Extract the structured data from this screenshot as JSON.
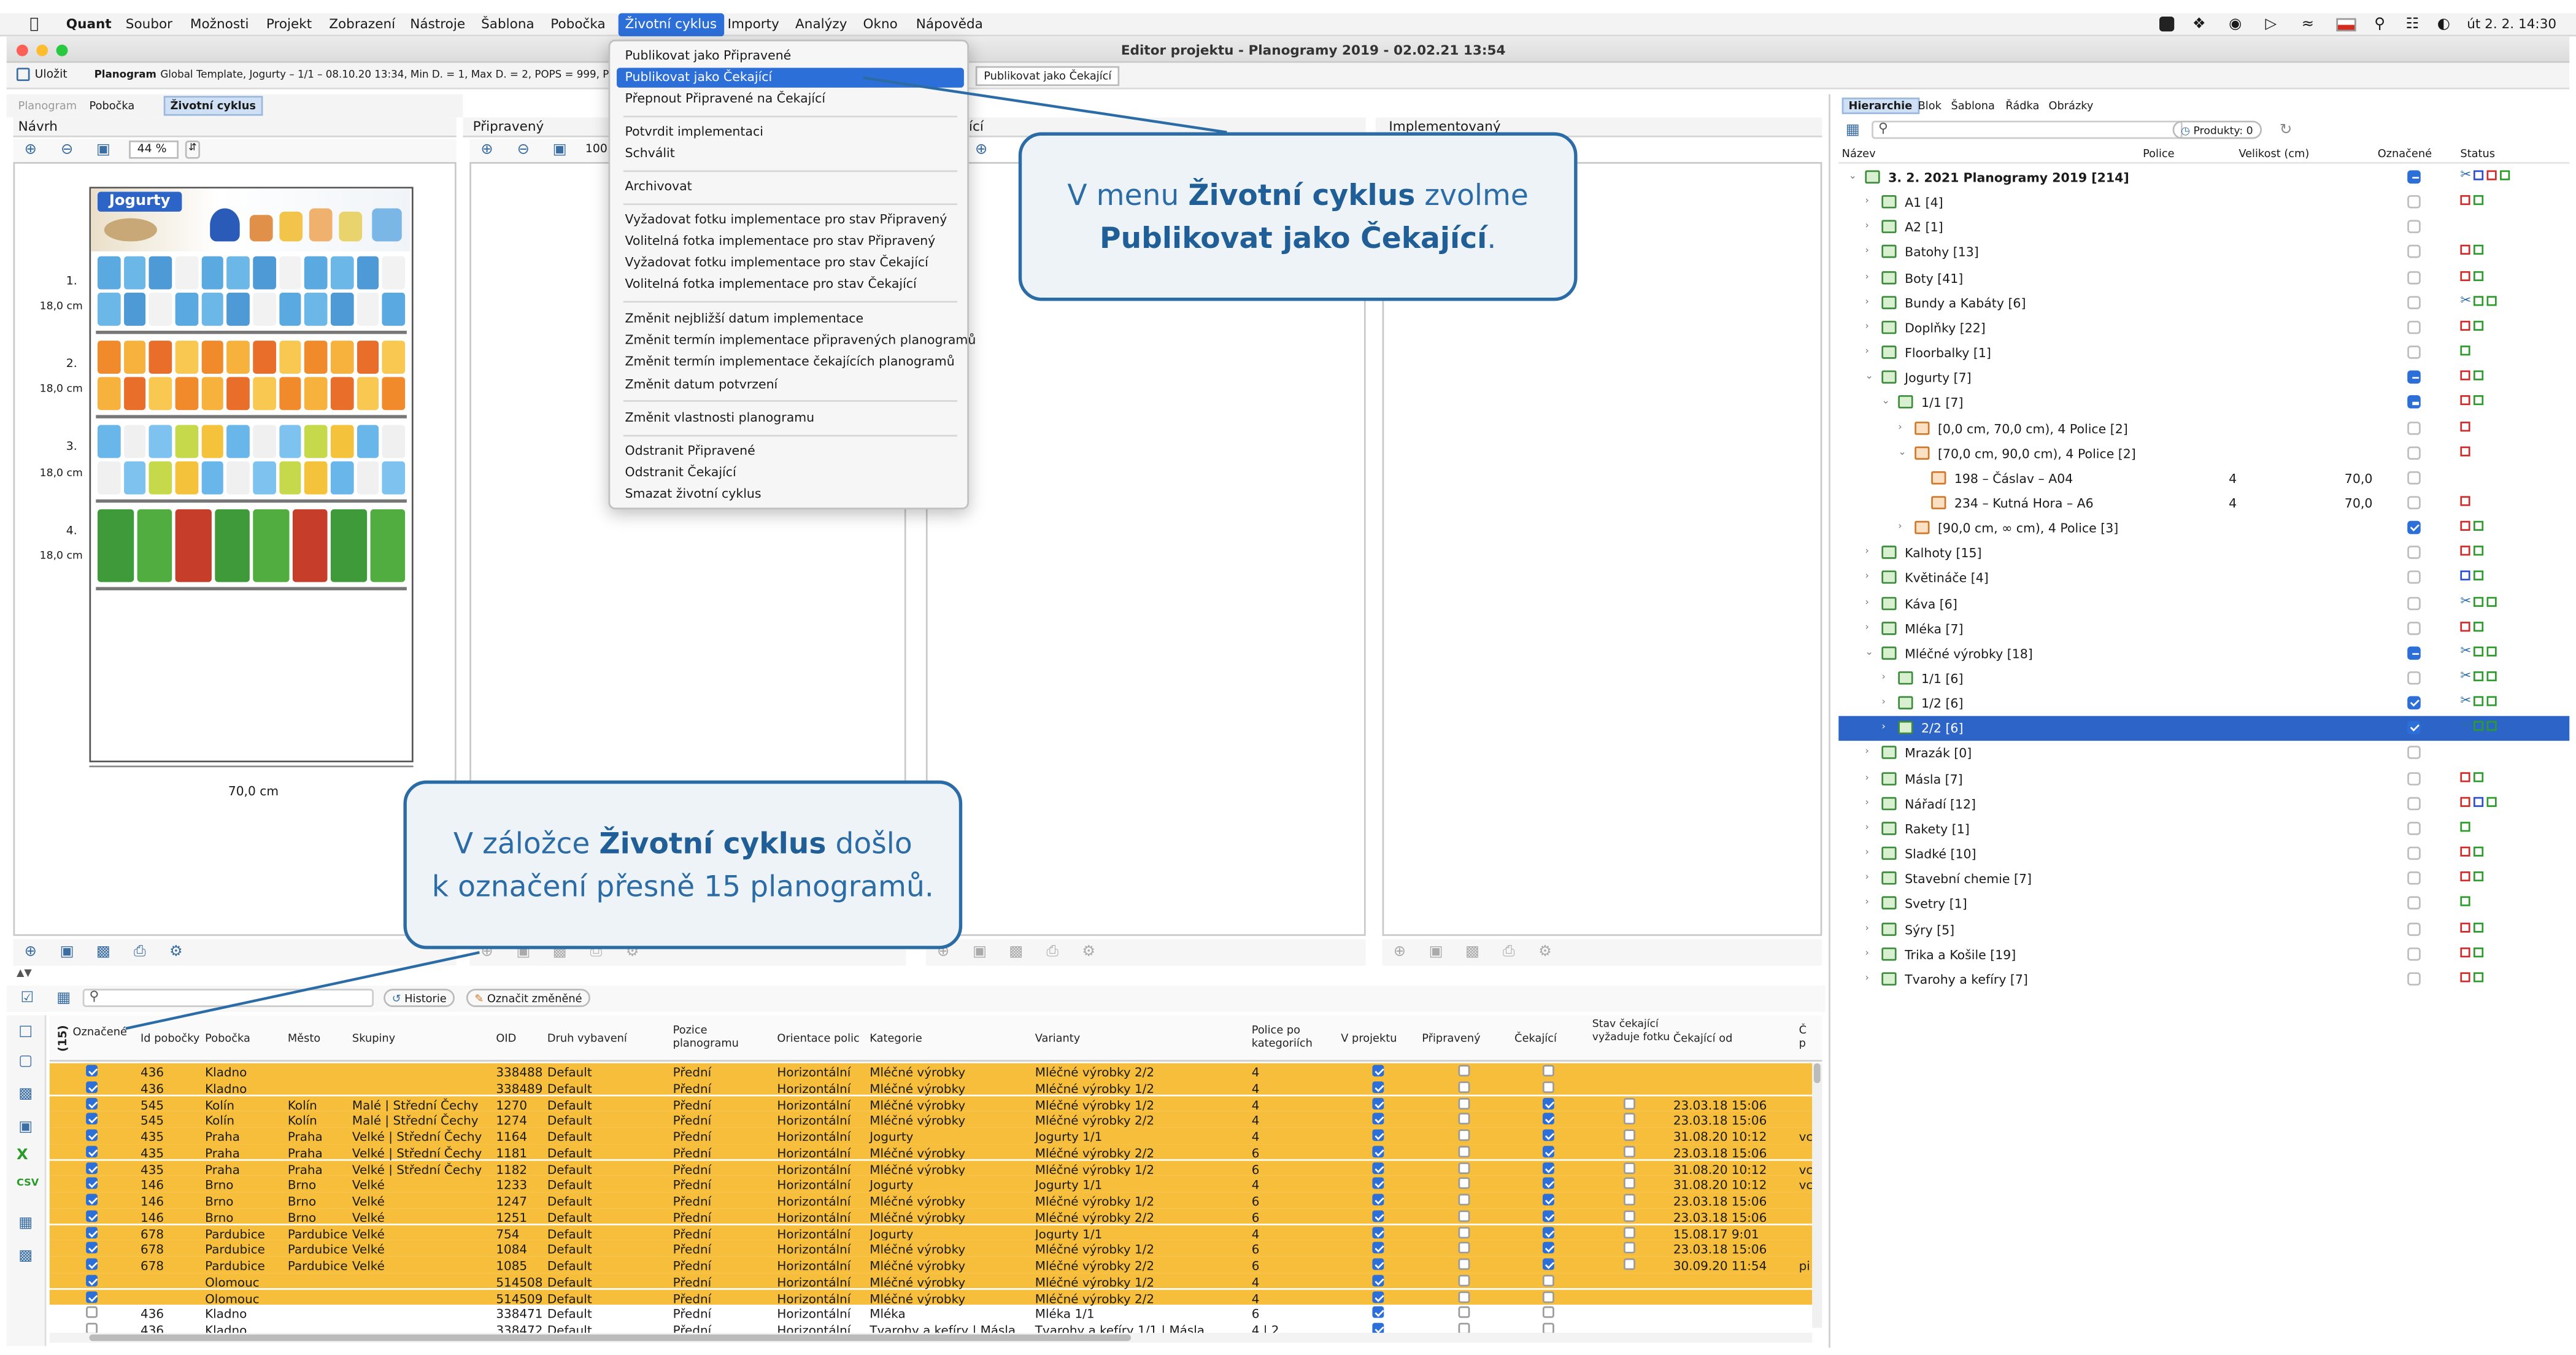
{
  "menubar": {
    "apple": "",
    "app": "Quant",
    "items": [
      "Soubor",
      "Možnosti",
      "Projekt",
      "Zobrazení",
      "Nástroje",
      "Šablona",
      "Pobočka",
      "Životní cyklus",
      "Importy",
      "Analýzy",
      "Okno",
      "Nápověda"
    ],
    "clock": "út 2. 2.  14:30"
  },
  "window": {
    "title": "Editor projektu - Planogramy 2019 - 02.02.21 13:54",
    "save_label": "Uložit",
    "planogram_label": "Planogram",
    "planogram_info": "Global Template, Jogurty – 1/1 – 08.10.20 13:34, Min D. = 1, Max D. = 2, POPS = 999, Prodan",
    "tooltip": "Publikovat jako Čekající"
  },
  "left_tabs": [
    "Planogram",
    "Pobočka",
    "Životní cyklus"
  ],
  "panes": {
    "navrh": "Návrh",
    "pripraveny": "Připravený",
    "cekajici": "ící",
    "implementovany": "Implementovaný",
    "zoom": "44 %",
    "zoom2": "100",
    "width_label": "70,0 cm",
    "shelf_no": [
      "1.",
      "2.",
      "3.",
      "4."
    ],
    "shelf_h": [
      "18,0 cm",
      "18,0 cm",
      "18,0 cm",
      "18,0 cm"
    ],
    "header_label": "Jogurty"
  },
  "menu": {
    "items": [
      "Publikovat jako Připravené",
      "Publikovat jako Čekající",
      "Přepnout Připravené na Čekající",
      "Potvrdit implementaci",
      "Schválit",
      "Archivovat",
      "Vyžadovat fotku implementace pro stav Připravený",
      "Volitelná fotka implementace pro stav Připravený",
      "Vyžadovat fotku implementace pro stav Čekající",
      "Volitelná fotka implementace pro stav Čekající",
      "Změnit nejbližší datum implementace",
      "Změnit termín implementace připravených planogramů",
      "Změnit termín implementace čekajících planogramů",
      "Změnit datum potvrzení",
      "Změnit vlastnosti planogramu",
      "Odstranit Připravené",
      "Odstranit Čekající",
      "Smazat životní cyklus"
    ]
  },
  "callouts": {
    "top_pre": "V menu ",
    "top_b1": "Životní cyklus",
    "top_mid": " zvolme",
    "top_b2": "Publikovat jako Čekající",
    "top_end": ".",
    "bottom_pre": "V záložce ",
    "bottom_b": "Životní cyklus",
    "bottom_mid": " došlo",
    "bottom_line2": "k označení přesně 15 planogramů."
  },
  "right": {
    "tabs": [
      "Hierarchie",
      "Blok",
      "Šablona",
      "Řádka",
      "Obrázky"
    ],
    "products": "Produkty: 0",
    "cols": [
      "Název",
      "Police",
      "Velikost (cm)",
      "Označené",
      "Status"
    ],
    "rows": [
      {
        "l": "3. 2. 2021 Planogramy 2019 [214]",
        "bold": true
      },
      {
        "l": "A1 [4]"
      },
      {
        "l": "A2 [1]"
      },
      {
        "l": "Batohy [13]"
      },
      {
        "l": "Boty [41]"
      },
      {
        "l": "Bundy a Kabáty [6]"
      },
      {
        "l": "Doplňky [22]"
      },
      {
        "l": "Floorbalky [1]"
      },
      {
        "l": "Jogurty [7]"
      },
      {
        "l": "1/1 [7]"
      },
      {
        "l": "[0,0 cm, 70,0 cm), 4 Police [2]"
      },
      {
        "l": "[70,0 cm, 90,0 cm), 4 Police [2]"
      },
      {
        "l": "198 – Čáslav – A04",
        "p": "4",
        "v": "70,0"
      },
      {
        "l": "234 – Kutná Hora – A6",
        "p": "4",
        "v": "70,0"
      },
      {
        "l": "[90,0 cm, ∞ cm), 4 Police [3]"
      },
      {
        "l": "Kalhoty [15]"
      },
      {
        "l": "Květináče [4]"
      },
      {
        "l": "Káva [6]"
      },
      {
        "l": "Mléka [7]"
      },
      {
        "l": "Mléčné výrobky [18]"
      },
      {
        "l": "1/1 [6]"
      },
      {
        "l": "1/2 [6]"
      },
      {
        "l": "2/2 [6]"
      },
      {
        "l": "Mrazák [0]"
      },
      {
        "l": "Másla [7]"
      },
      {
        "l": "Nářadí [12]"
      },
      {
        "l": "Rakety [1]"
      },
      {
        "l": "Sladké [10]"
      },
      {
        "l": "Stavební chemie [7]"
      },
      {
        "l": "Svetry [1]"
      },
      {
        "l": "Sýry [5]"
      },
      {
        "l": "Trika a Košile [19]"
      },
      {
        "l": "Tvarohy a kefíry [7]"
      }
    ]
  },
  "grid": {
    "history": "Historie",
    "mark_changed": "Označit změněné",
    "count_label": "(15)",
    "cols": [
      "Označené",
      "Id pobočky",
      "Pobočka",
      "Město",
      "Skupiny",
      "OID",
      "Druh vybavení",
      "Pozice planogramu",
      "Orientace polic",
      "Kategorie",
      "Varianty",
      "Police po kategoriích",
      "V projektu",
      "Připravený",
      "Čekající",
      "Stav čekající vyžaduje fotku",
      "Čekající od",
      "Č p"
    ],
    "rows": [
      {
        "id": "436",
        "po": "Kladno",
        "m": "",
        "s": "",
        "oid": "338488",
        "d": "Default",
        "poz": "Přední",
        "o": "Horizontální",
        "k": "Mléčné výrobky",
        "v": "Mléčné výrobky 2/2",
        "p": "4",
        "ck": false,
        "od": "",
        "x": ""
      },
      {
        "id": "436",
        "po": "Kladno",
        "m": "",
        "s": "",
        "oid": "338489",
        "d": "Default",
        "poz": "Přední",
        "o": "Horizontální",
        "k": "Mléčné výrobky",
        "v": "Mléčné výrobky 1/2",
        "p": "4",
        "ck": false,
        "od": "",
        "x": ""
      },
      {
        "id": "545",
        "po": "Kolín",
        "m": "Kolín",
        "s": "Malé | Střední Čechy",
        "oid": "1270",
        "d": "Default",
        "poz": "Přední",
        "o": "Horizontální",
        "k": "Mléčné výrobky",
        "v": "Mléčné výrobky 1/2",
        "p": "4",
        "ck": true,
        "od": "23.03.18 15:06",
        "x": ""
      },
      {
        "id": "545",
        "po": "Kolín",
        "m": "Kolín",
        "s": "Malé | Střední Čechy",
        "oid": "1274",
        "d": "Default",
        "poz": "Přední",
        "o": "Horizontální",
        "k": "Mléčné výrobky",
        "v": "Mléčné výrobky 2/2",
        "p": "4",
        "ck": true,
        "od": "23.03.18 15:06",
        "x": ""
      },
      {
        "id": "435",
        "po": "Praha",
        "m": "Praha",
        "s": "Velké | Střední Čechy",
        "oid": "1164",
        "d": "Default",
        "poz": "Přední",
        "o": "Horizontální",
        "k": "Jogurty",
        "v": "Jogurty 1/1",
        "p": "4",
        "ck": true,
        "od": "31.08.20 10:12",
        "x": "vc"
      },
      {
        "id": "435",
        "po": "Praha",
        "m": "Praha",
        "s": "Velké | Střední Čechy",
        "oid": "1181",
        "d": "Default",
        "poz": "Přední",
        "o": "Horizontální",
        "k": "Mléčné výrobky",
        "v": "Mléčné výrobky 2/2",
        "p": "6",
        "ck": true,
        "od": "23.03.18 15:06",
        "x": ""
      },
      {
        "id": "435",
        "po": "Praha",
        "m": "Praha",
        "s": "Velké | Střední Čechy",
        "oid": "1182",
        "d": "Default",
        "poz": "Přední",
        "o": "Horizontální",
        "k": "Mléčné výrobky",
        "v": "Mléčné výrobky 1/2",
        "p": "6",
        "ck": true,
        "od": "31.08.20 10:12",
        "x": "vc"
      },
      {
        "id": "146",
        "po": "Brno",
        "m": "Brno",
        "s": "Velké",
        "oid": "1233",
        "d": "Default",
        "poz": "Přední",
        "o": "Horizontální",
        "k": "Jogurty",
        "v": "Jogurty 1/1",
        "p": "4",
        "ck": true,
        "od": "31.08.20 10:12",
        "x": "vc"
      },
      {
        "id": "146",
        "po": "Brno",
        "m": "Brno",
        "s": "Velké",
        "oid": "1247",
        "d": "Default",
        "poz": "Přední",
        "o": "Horizontální",
        "k": "Mléčné výrobky",
        "v": "Mléčné výrobky 1/2",
        "p": "6",
        "ck": true,
        "od": "23.03.18 15:06",
        "x": ""
      },
      {
        "id": "146",
        "po": "Brno",
        "m": "Brno",
        "s": "Velké",
        "oid": "1251",
        "d": "Default",
        "poz": "Přední",
        "o": "Horizontální",
        "k": "Mléčné výrobky",
        "v": "Mléčné výrobky 2/2",
        "p": "6",
        "ck": true,
        "od": "23.03.18 15:06",
        "x": ""
      },
      {
        "id": "678",
        "po": "Pardubice",
        "m": "Pardubice",
        "s": "Velké",
        "oid": "754",
        "d": "Default",
        "poz": "Přední",
        "o": "Horizontální",
        "k": "Jogurty",
        "v": "Jogurty 1/1",
        "p": "4",
        "ck": true,
        "od": "15.08.17 9:01",
        "x": ""
      },
      {
        "id": "678",
        "po": "Pardubice",
        "m": "Pardubice",
        "s": "Velké",
        "oid": "1084",
        "d": "Default",
        "poz": "Přední",
        "o": "Horizontální",
        "k": "Mléčné výrobky",
        "v": "Mléčné výrobky 1/2",
        "p": "6",
        "ck": true,
        "od": "23.03.18 15:06",
        "x": ""
      },
      {
        "id": "678",
        "po": "Pardubice",
        "m": "Pardubice",
        "s": "Velké",
        "oid": "1085",
        "d": "Default",
        "poz": "Přední",
        "o": "Horizontální",
        "k": "Mléčné výrobky",
        "v": "Mléčné výrobky 2/2",
        "p": "6",
        "ck": true,
        "od": "30.09.20 11:54",
        "x": "pi"
      },
      {
        "id": "",
        "po": "Olomouc",
        "m": "",
        "s": "",
        "oid": "514508",
        "d": "Default",
        "poz": "Přední",
        "o": "Horizontální",
        "k": "Mléčné výrobky",
        "v": "Mléčné výrobky 1/2",
        "p": "4",
        "ck": false,
        "od": "",
        "x": ""
      },
      {
        "id": "",
        "po": "Olomouc",
        "m": "",
        "s": "",
        "oid": "514509",
        "d": "Default",
        "poz": "Přední",
        "o": "Horizontální",
        "k": "Mléčné výrobky",
        "v": "Mléčné výrobky 2/2",
        "p": "4",
        "ck": false,
        "od": "",
        "x": ""
      },
      {
        "id": "436",
        "po": "Kladno",
        "m": "",
        "s": "",
        "oid": "338471",
        "d": "Default",
        "poz": "Přední",
        "o": "Horizontální",
        "k": "Mléka",
        "v": "Mléka 1/1",
        "p": "6",
        "ck": false,
        "od": "",
        "x": ""
      },
      {
        "id": "436",
        "po": "Kladno",
        "m": "",
        "s": "",
        "oid": "338472",
        "d": "Default",
        "poz": "Přední",
        "o": "Horizontální",
        "k": "Tvarohy a kefíry | Másla",
        "v": "Tvarohy a kefíry 1/1 | Másla",
        "p": "4 | 2",
        "ck": false,
        "od": "",
        "x": ""
      }
    ]
  }
}
